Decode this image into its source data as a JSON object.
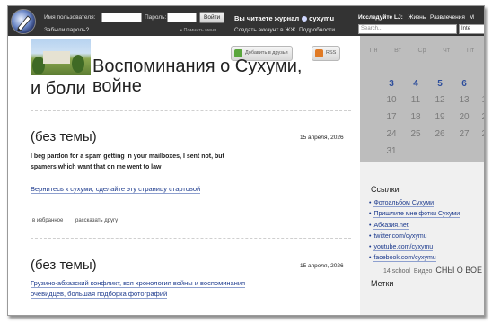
{
  "ljbar": {
    "username_label": "Имя пользователя:",
    "password_label": "Пароль:",
    "login_button": "Войти",
    "forgot_password": "Забыли пароль?",
    "remember_me": "Помнить меня",
    "reading_label": "Вы читаете журнал",
    "journal_user": "cyxymu",
    "create_account": "Создать аккаунт в ЖЖ",
    "details": "Подробности",
    "explore_label": "Исследуйте LJ:",
    "explore_links": [
      "Жизнь",
      "Развлечения",
      "М"
    ],
    "search_placeholder": "Search...",
    "search_scope": "Inte"
  },
  "header": {
    "add_friend": "Добавить в друзья",
    "rss": "RSS",
    "title_line1": "Воспоминания о Сухуми, войне",
    "title_line2": "и боли"
  },
  "posts": [
    {
      "heading": "(без темы)",
      "date": "15 апреля, 2026",
      "body_line1": "I beg pardon for a spam getting in your mailboxes, I sent not, but",
      "body_line2": "spamers which want that on me went to law",
      "link": "Вернитесь к сухуми, сделайте эту страницу стартовой",
      "action_fav": "в избранное",
      "action_share": "рассказать другу"
    },
    {
      "heading": "(без темы)",
      "date": "15 апреля, 2026",
      "link_line1": "Грузино-абхазский конфликт, вся хронология войны и воспоминания",
      "link_line2": "очевидцев, большая подборка фотографий"
    }
  ],
  "calendar": {
    "weekdays": [
      "Пн",
      "Вт",
      "Ср",
      "Чт",
      "Пт"
    ],
    "rows": [
      [
        "3",
        "4",
        "5",
        "6"
      ],
      [
        "10",
        "11",
        "12",
        "13",
        "14"
      ],
      [
        "17",
        "18",
        "19",
        "20",
        "21"
      ],
      [
        "24",
        "25",
        "26",
        "27",
        "28"
      ],
      [
        "31"
      ]
    ]
  },
  "sidebar": {
    "links_title": "Ссылки",
    "links": [
      "Фотоальбом Сухуми",
      "Пришлите мне фотки Сухуми",
      "Абхазия.net",
      "twitter.com/cyxymu",
      "youtube.com/cyxymu",
      "facebook.com/cyxymu"
    ],
    "tags_title": "Метки",
    "tags": [
      "14 school",
      "Видео",
      "СНЫ О ВОЕ"
    ]
  },
  "colors": {
    "topbar": "#333333",
    "link": "#1c3a8d",
    "calendar_bg": "#bdbdbd",
    "calendar_current": "#2d4e9c",
    "add_friend_icon": "#5aa63d",
    "rss_icon": "#e07a25"
  }
}
